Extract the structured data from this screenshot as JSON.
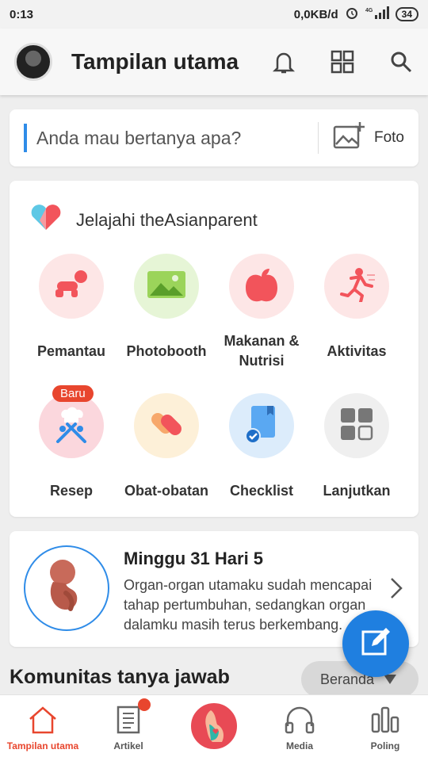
{
  "status_bar": {
    "time": "0:13",
    "network": "0,0KB/d",
    "signal": "4G",
    "battery": "34"
  },
  "header": {
    "title": "Tampilan utama"
  },
  "ask": {
    "placeholder": "Anda mau bertanya apa?",
    "photo_label": "Foto"
  },
  "explore": {
    "title": "Jelajahi theAsianparent",
    "items": [
      {
        "label": "Pemantau",
        "icon": "baby-crawl-icon",
        "color": "#fde6e6"
      },
      {
        "label": "Photobooth",
        "icon": "image-icon",
        "color": "#e6f5d6"
      },
      {
        "label": "Makanan &\nNutrisi",
        "icon": "apple-icon",
        "color": "#fde6e6"
      },
      {
        "label": "Aktivitas",
        "icon": "running-icon",
        "color": "#fde6e6"
      },
      {
        "label": "Resep",
        "icon": "chef-icon",
        "color": "#fbd7dd",
        "badge": "Baru"
      },
      {
        "label": "Obat-obatan",
        "icon": "pill-icon",
        "color": "#fdf0d8"
      },
      {
        "label": "Checklist",
        "icon": "checklist-icon",
        "color": "#dcecfb"
      },
      {
        "label": "Lanjutkan",
        "icon": "more-grid-icon",
        "color": "#efefef"
      }
    ]
  },
  "pregnancy": {
    "title": "Minggu 31 Hari 5",
    "description": "Organ-organ utamaku sudah mencapai tahap pertumbuhan, sedangkan organ dalamku masih terus berkembang."
  },
  "community": {
    "title": "Komunitas tanya jawab",
    "filter": "Beranda"
  },
  "bottom_nav": [
    {
      "label": "Tampilan utama",
      "icon": "home-icon",
      "active": true
    },
    {
      "label": "Artikel",
      "icon": "article-icon"
    },
    {
      "label": "",
      "icon": "pregnancy-icon"
    },
    {
      "label": "Media",
      "icon": "headphones-icon"
    },
    {
      "label": "Poling",
      "icon": "poll-icon"
    }
  ],
  "colors": {
    "accent": "#e8462e",
    "primary_blue": "#1f7fe0"
  }
}
